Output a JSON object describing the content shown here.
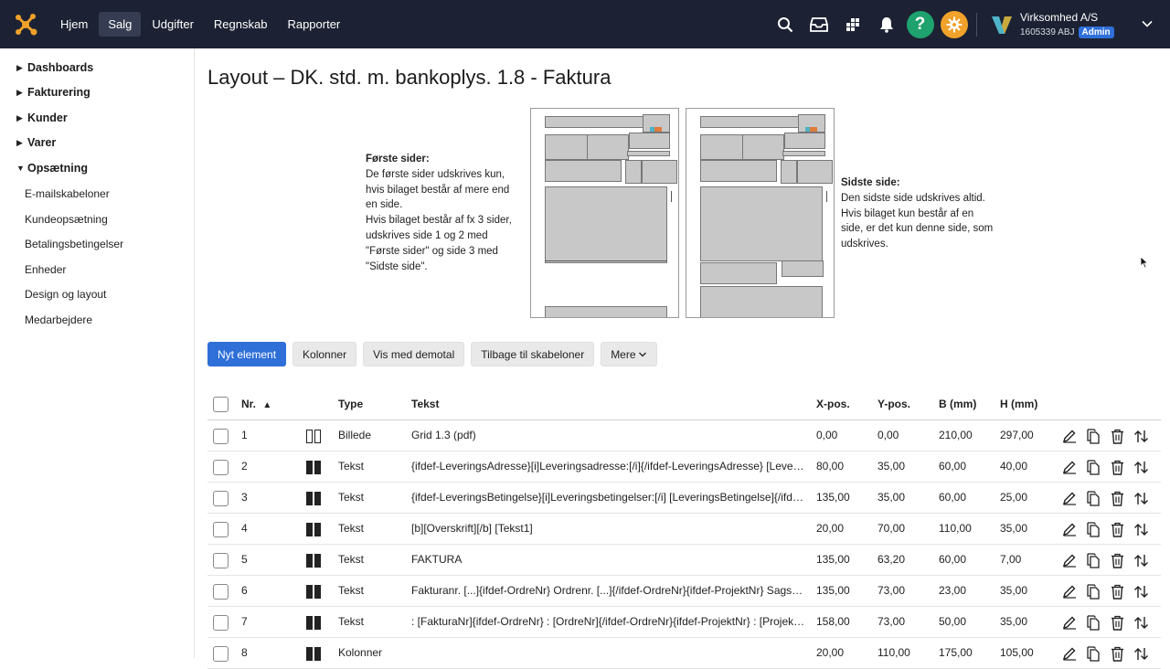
{
  "topbar": {
    "nav": [
      "Hjem",
      "Salg",
      "Udgifter",
      "Regnskab",
      "Rapporter"
    ],
    "active_nav": "Salg",
    "help_label": "?",
    "company": {
      "name": "Virksomhed A/S",
      "id": "1605339 ABJ",
      "role": "Admin"
    },
    "colors": {
      "background": "#1c2233",
      "help": "#1ea26e",
      "settings": "#f0a22a",
      "badge": "#2f6fd8"
    }
  },
  "sidebar": {
    "groups": [
      {
        "label": "Dashboards",
        "expanded": false
      },
      {
        "label": "Fakturering",
        "expanded": false
      },
      {
        "label": "Kunder",
        "expanded": false
      },
      {
        "label": "Varer",
        "expanded": false
      },
      {
        "label": "Opsætning",
        "expanded": true
      }
    ],
    "items": [
      "E-mailskabeloner",
      "Kundeopsætning",
      "Betalingsbetingelser",
      "Enheder",
      "Design og layout",
      "Medarbejdere"
    ]
  },
  "page": {
    "title": "Layout – DK. std. m. bankoplys. 1.8 - Faktura",
    "first_pages": {
      "heading": "Første sider:",
      "lines": [
        "De første sider udskrives kun,",
        "hvis bilaget består af mere end",
        "en side.",
        "Hvis bilaget består af fx 3 sider,",
        "udskrives side 1 og 2 med",
        "\"Første sider\" og side 3 med",
        "\"Sidste side\"."
      ]
    },
    "last_page": {
      "heading": "Sidste side:",
      "lines": [
        "Den sidste side udskrives altid.",
        "Hvis bilaget kun består af en",
        "side, er det kun denne side, som",
        "udskrives."
      ]
    }
  },
  "toolbar": {
    "new_element": "Nyt element",
    "columns": "Kolonner",
    "demo": "Vis med demotal",
    "back": "Tilbage til skabeloner",
    "more": "Mere"
  },
  "table": {
    "headers": {
      "nr": "Nr.",
      "type": "Type",
      "text": "Tekst",
      "x": "X-pos.",
      "y": "Y-pos.",
      "w": "B (mm)",
      "h": "H (mm)"
    },
    "sort_column": "Nr.",
    "sort_direction": "ascending",
    "rows": [
      {
        "nr": "1",
        "type": "Billede",
        "icon": "outline",
        "text": "Grid 1.3 (pdf)",
        "x": "0,00",
        "y": "0,00",
        "w": "210,00",
        "h": "297,00"
      },
      {
        "nr": "2",
        "type": "Tekst",
        "icon": "filled",
        "text": "{ifdef-LeveringsAdresse}[i]Leveringsadresse:[/i]{/ifdef-LeveringsAdresse} [LeveringsAdresse]",
        "x": "80,00",
        "y": "35,00",
        "w": "60,00",
        "h": "40,00"
      },
      {
        "nr": "3",
        "type": "Tekst",
        "icon": "filled",
        "text": "{ifdef-LeveringsBetingelse}[i]Leveringsbetingelser:[/i] [LeveringsBetingelse]{/ifdef-LeveringsBetingelse}",
        "x": "135,00",
        "y": "35,00",
        "w": "60,00",
        "h": "25,00"
      },
      {
        "nr": "4",
        "type": "Tekst",
        "icon": "filled",
        "text": "[b][Overskrift][/b] [Tekst1]",
        "x": "20,00",
        "y": "70,00",
        "w": "110,00",
        "h": "35,00"
      },
      {
        "nr": "5",
        "type": "Tekst",
        "icon": "filled",
        "text": "FAKTURA",
        "x": "135,00",
        "y": "63,20",
        "w": "60,00",
        "h": "7,00"
      },
      {
        "nr": "6",
        "type": "Tekst",
        "icon": "filled",
        "text": "Fakturanr. [...]{ifdef-OrdreNr} Ordrenr. [...]{/ifdef-OrdreNr}{ifdef-ProjektNr} Sagsnr. [...]{/ifdef-ProjektNr}",
        "x": "135,00",
        "y": "73,00",
        "w": "23,00",
        "h": "35,00"
      },
      {
        "nr": "7",
        "type": "Tekst",
        "icon": "filled",
        "text": ": [FakturaNr]{ifdef-OrdreNr} : [OrdreNr]{/ifdef-OrdreNr}{ifdef-ProjektNr} : [ProjektNr]{/ifdef-ProjektNr}",
        "x": "158,00",
        "y": "73,00",
        "w": "50,00",
        "h": "35,00"
      },
      {
        "nr": "8",
        "type": "Kolonner",
        "icon": "filled",
        "text": "",
        "x": "20,00",
        "y": "110,00",
        "w": "175,00",
        "h": "105,00"
      }
    ]
  }
}
